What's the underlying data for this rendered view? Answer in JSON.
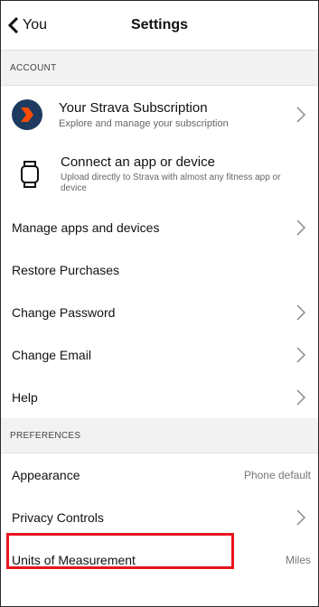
{
  "header": {
    "back_label": "You",
    "title": "Settings"
  },
  "account": {
    "section_label": "ACCOUNT",
    "subscription": {
      "title": "Your Strava Subscription",
      "description": "Explore and manage your subscription"
    },
    "connect": {
      "title": "Connect an app or device",
      "description": "Upload directly to Strava with almost any fitness app or device"
    },
    "items": [
      {
        "label": "Manage apps and devices"
      },
      {
        "label": "Restore Purchases"
      },
      {
        "label": "Change Password"
      },
      {
        "label": "Change Email"
      },
      {
        "label": "Help"
      }
    ]
  },
  "preferences": {
    "section_label": "PREFERENCES",
    "items": [
      {
        "label": "Appearance",
        "value": "Phone default"
      },
      {
        "label": "Privacy Controls"
      },
      {
        "label": "Units of Measurement",
        "value": "Miles"
      }
    ]
  },
  "colors": {
    "highlight": "#e8141e",
    "strava_badge_bg": "#1e3a5f",
    "strava_orange": "#fc4c02"
  },
  "icons": {
    "back": "chevron-left-icon",
    "subscription": "strava-subscription-icon",
    "device": "watch-icon",
    "chevron": "chevron-right-icon"
  }
}
